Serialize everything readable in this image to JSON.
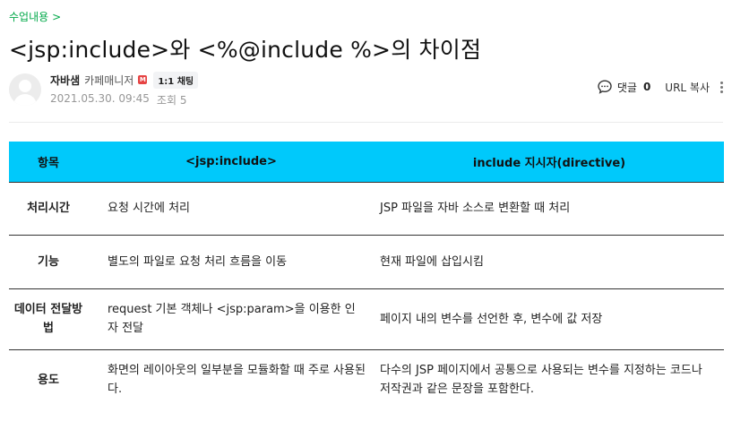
{
  "breadcrumb": {
    "label": "수업내용",
    "chevron": ">"
  },
  "title": "<jsp:include>와 <%@include %>의 차이점",
  "author": {
    "nickname": "자바샘",
    "role": "카페매니저",
    "role_icon": "manager-badge-icon",
    "chat_label": "1:1 채팅",
    "date": "2021.05.30. 09:45",
    "views": "조회 5"
  },
  "actions": {
    "comment_label": "댓글",
    "comment_count": "0",
    "url_copy_label": "URL 복사"
  },
  "table": {
    "headers": [
      "항목",
      "<jsp:include>",
      "include 지시자(directive)"
    ],
    "rows": [
      {
        "item": "처리시간",
        "jsp_include": "요청 시간에 처리",
        "directive": "JSP 파일을 자바 소스로 변환할 때 처리"
      },
      {
        "item": "기능",
        "jsp_include": "별도의 파일로 요청 처리 흐름을 이동",
        "directive": "현재 파일에 삽입시킴"
      },
      {
        "item": "데이터 전달방법",
        "jsp_include": "request 기본 객체나 <jsp:param>을 이용한 인자 전달",
        "directive": "페이지 내의 변수를 선언한 후, 변수에 값 저장"
      },
      {
        "item": "용도",
        "jsp_include": "화면의 레이아웃의 일부분을 모듈화할 때 주로 사용된다.",
        "directive": "다수의 JSP 페이지에서 공통으로 사용되는 변수를 지정하는 코드나 저작권과 같은 문장을 포함한다."
      }
    ],
    "header_color": "#00c9fb"
  }
}
